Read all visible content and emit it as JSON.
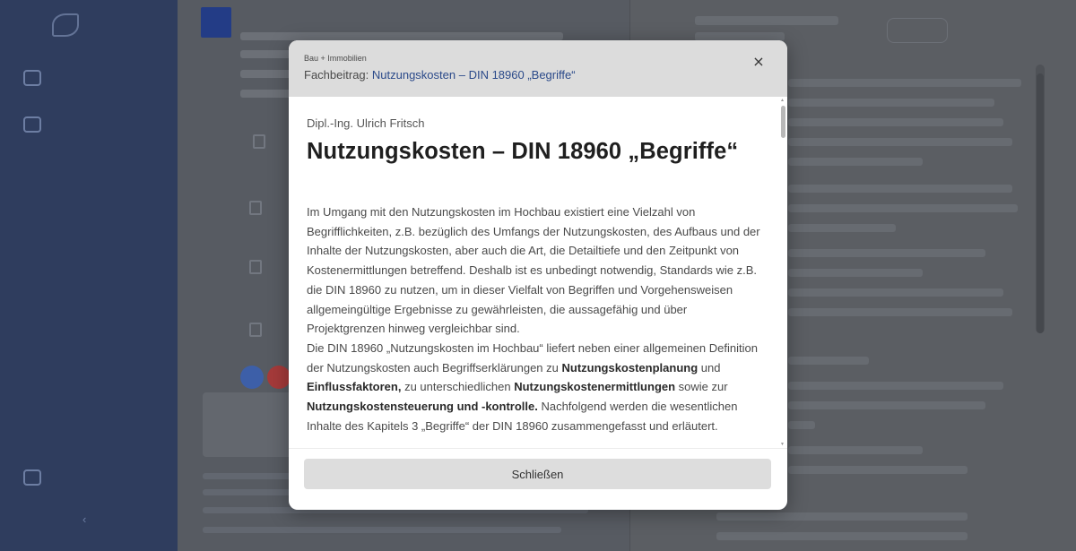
{
  "modal": {
    "category": "Bau + Immobilien",
    "title_prefix": "Fachbeitrag:",
    "title_link": "Nutzungskosten – DIN 18960 „Begriffe“",
    "close_icon": "×",
    "author": "Dipl.-Ing. Ulrich Fritsch",
    "article_title": "Nutzungskosten – DIN 18960 „Begriffe“",
    "p1": "Im Umgang mit den Nutzungskosten im Hochbau existiert eine Vielzahl von Begrifflichkeiten, z.B. bezüglich des Umfangs der Nutzungskosten, des Aufbaus und der Inhalte der Nutzungskosten, aber auch die Art, die Detailtiefe und den Zeitpunkt von Kostenermittlungen betreffend. Deshalb ist es unbedingt notwendig, Standards wie z.B. die DIN 18960 zu nutzen, um in dieser Vielfalt von Begriffen und Vorgehensweisen allgemeingültige Ergebnisse zu gewährleisten, die aussagefähig und über Projektgrenzen hinweg vergleichbar sind.",
    "p2_a": "Die DIN 18960 „Nutzungskosten im Hochbau“ liefert neben einer allgemeinen Definition der Nutzungskosten auch Begriffserklärungen zu ",
    "p2_b1": "Nutzungskostenplanung",
    "p2_c": " und ",
    "p2_b2": "Einflussfaktoren,",
    "p2_d": " zu unterschiedlichen ",
    "p2_b3": "Nutzungskostenermittlungen",
    "p2_e": " sowie zur ",
    "p2_b4": "Nutzungskostensteuerung und -kontrolle.",
    "p2_f": " Nachfolgend werden die wesentlichen Inhalte des Kapitels 3 „Begriffe“ der DIN 18960 zusammengefasst und erläutert.",
    "close_button": "Schließen"
  },
  "icons": {
    "close": "close-icon",
    "scroll_up": "chevron-up-icon",
    "scroll_down": "chevron-down-icon"
  },
  "colors": {
    "link": "#2b4a8a",
    "sidebar": "#2f3d5e",
    "header_bg": "#dcdcdc"
  }
}
